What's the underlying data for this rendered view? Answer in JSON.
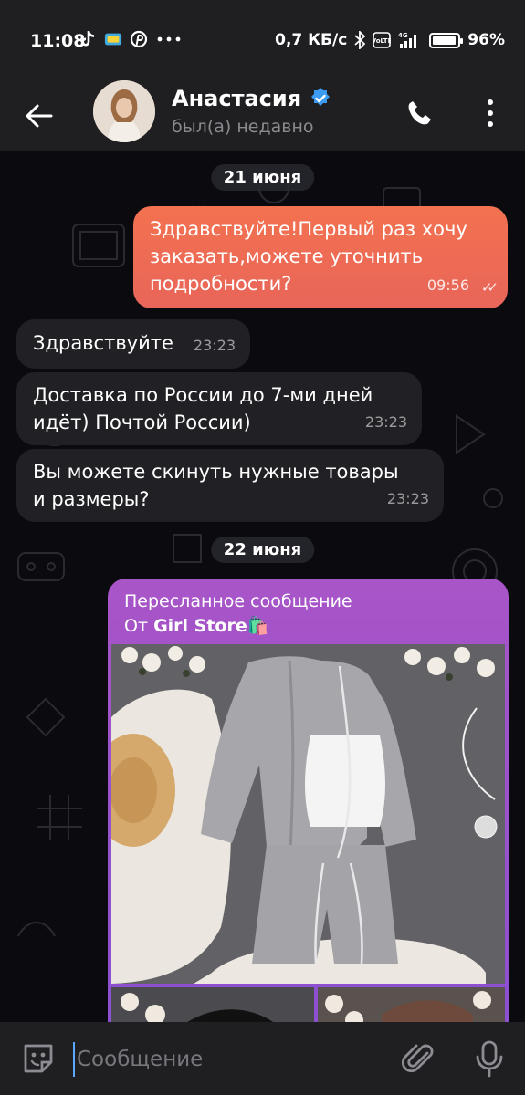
{
  "status_bar": {
    "time": "11:08",
    "apps": [
      "tiktok-icon",
      "game-icon",
      "pinterest-icon",
      "more-dots-icon"
    ],
    "network_speed": "0,7 КБ/с",
    "battery_percent": "96%",
    "battery_level": 0.96
  },
  "header": {
    "contact_name": "Анастасия",
    "status": "был(а) недавно"
  },
  "messages": [
    {
      "type": "date",
      "text": "21 июня"
    },
    {
      "type": "outgoing",
      "text_lines": [
        "Здравствуйте!Первый раз хочу",
        "заказать,можете уточнить",
        "подробности?"
      ],
      "time": "09:56",
      "read": true
    },
    {
      "type": "incoming",
      "text_lines": [
        "Здравствуйте"
      ],
      "time": "23:23"
    },
    {
      "type": "incoming",
      "text_lines": [
        "Доставка по России до 7-ми дней",
        "идёт) Почтой России)"
      ],
      "time": "23:23"
    },
    {
      "type": "incoming",
      "text_lines": [
        "Вы можете скинуть нужные товары",
        "и размеры?"
      ],
      "time": "23:23"
    },
    {
      "type": "date",
      "text": "22 июня"
    },
    {
      "type": "forwarded",
      "label": "Пересланное сообщение",
      "from_prefix": "От ",
      "from_name": "Girl Store",
      "from_emoji": "🛍️"
    }
  ],
  "input": {
    "placeholder": "Сообщение"
  },
  "colors": {
    "outgoing_bubble": "#f06f52",
    "incoming_bubble": "#212125",
    "forwarded_bubble": "#9a52cc",
    "verified_badge": "#3a9bf0",
    "bar_background": "#1f1f22"
  }
}
